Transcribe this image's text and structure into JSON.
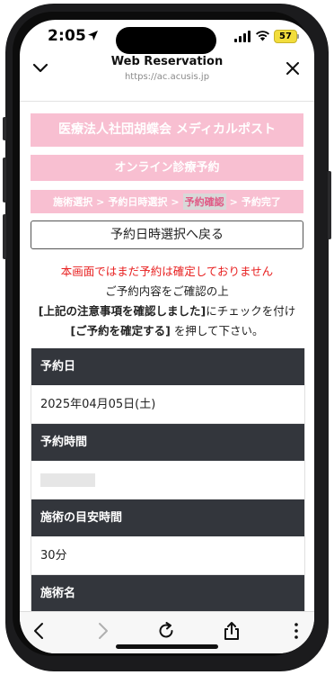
{
  "status_bar": {
    "time": "2:05",
    "battery": "57",
    "icons": [
      "location-arrow-icon",
      "signal-icon",
      "wifi-icon",
      "battery-icon"
    ]
  },
  "browser": {
    "title": "Web Reservation",
    "url": "https://ac.acusis.jp",
    "icons": [
      "chevron-down-icon",
      "close-icon"
    ]
  },
  "page": {
    "clinic_name": "医療法人社団胡蝶会 メディカルポスト",
    "section_title": "オンライン診療予約",
    "steps": [
      "施術選択",
      ">",
      "予約日時選択",
      ">",
      "予約確認",
      ">",
      "予約完了"
    ],
    "active_step": "予約確認",
    "back_button": "予約日時選択へ戻る",
    "warning": "本画面ではまだ予約は確定しておりません",
    "message_line1": "ご予約内容をご確認の上",
    "message_line2_bold": "[上記の注意事項を確認しました]",
    "message_line2_rest": "にチェックを付け",
    "message_line3_bold": "[ご予約を確定する]",
    "message_line3_rest": " を押して下さい。",
    "details": [
      {
        "label": "予約日",
        "value": "2025年04月05日(土)"
      },
      {
        "label": "予約時間",
        "value": ""
      },
      {
        "label": "施術の目安時間",
        "value": "30分"
      },
      {
        "label": "施術名",
        "value": ""
      }
    ]
  },
  "toolbar": {
    "icons": [
      "back-arrow-icon",
      "forward-arrow-icon",
      "reload-icon",
      "share-icon",
      "more-icon"
    ]
  },
  "colors": {
    "pink": "#f8bfd1",
    "header_dark": "#33363c",
    "warning_red": "#e82020",
    "battery_yellow": "#f2dd3c"
  }
}
